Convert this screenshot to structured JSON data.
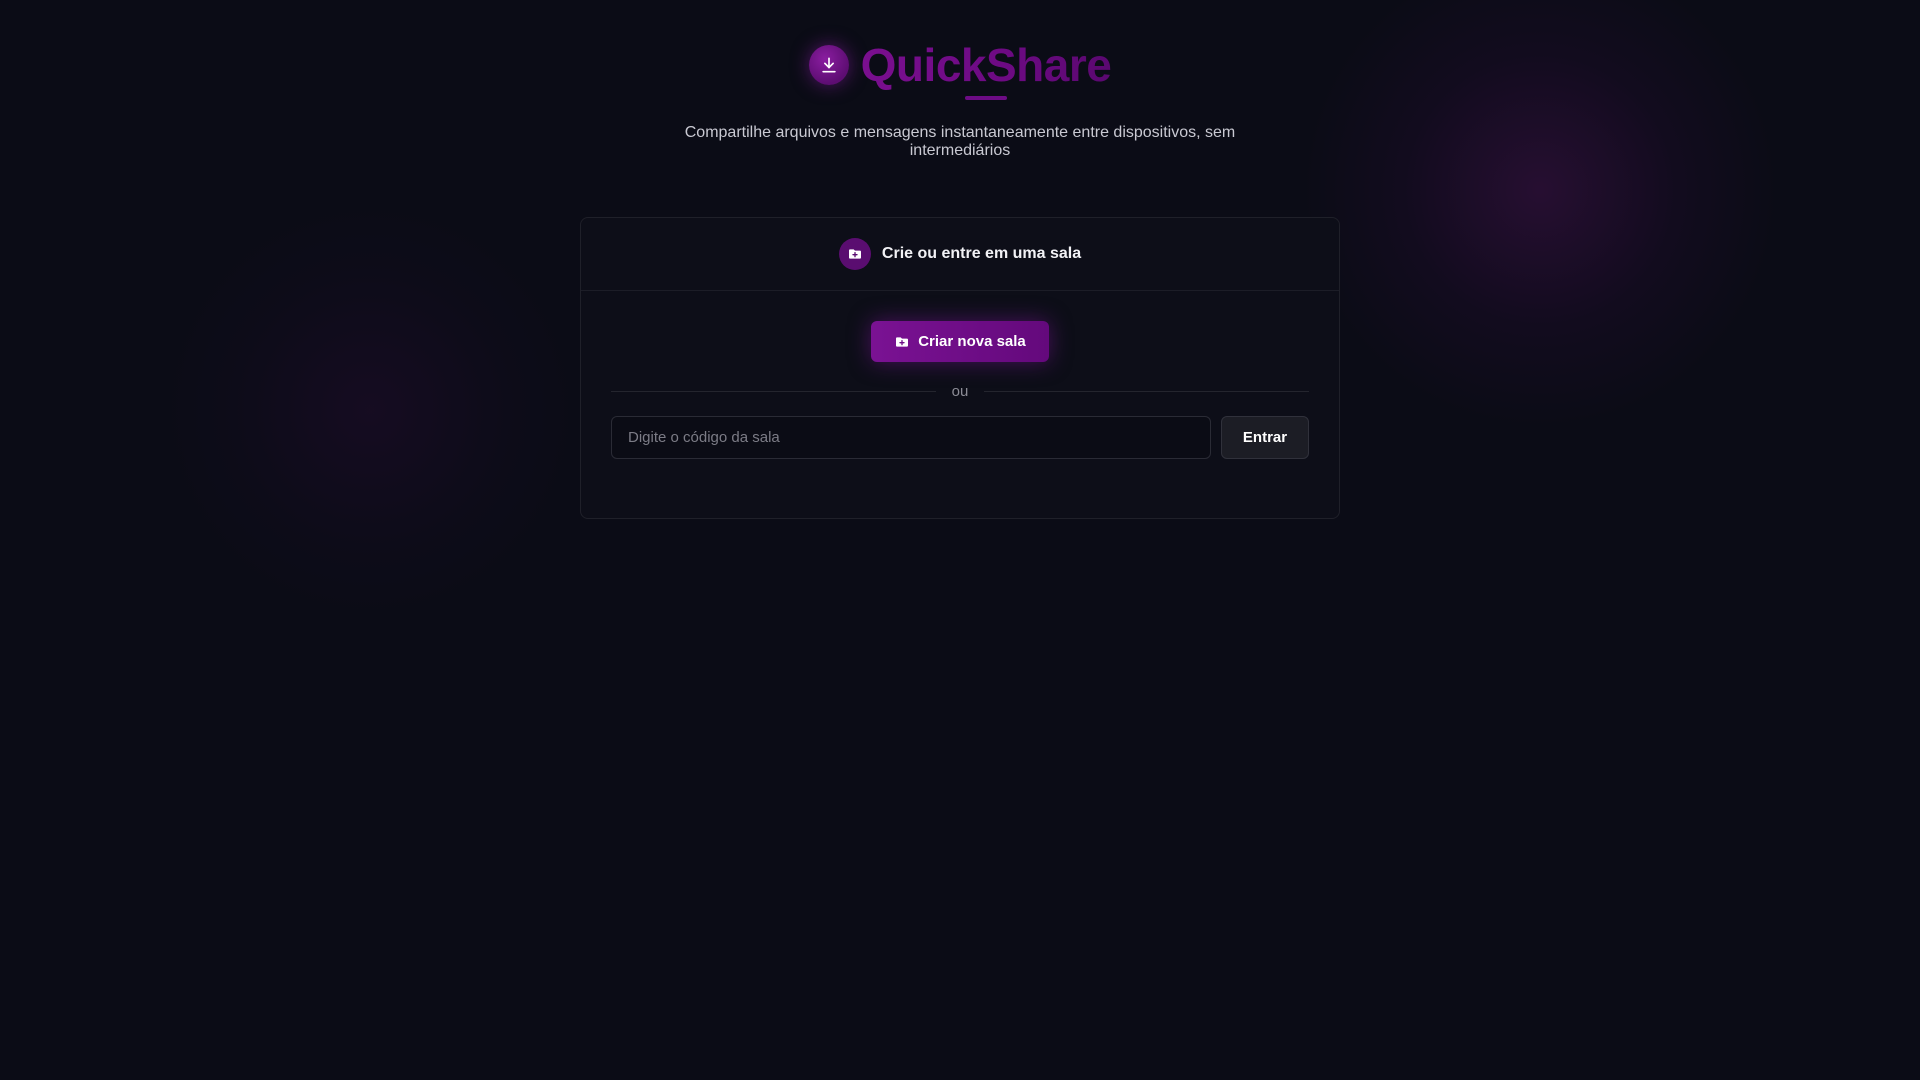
{
  "app": {
    "title": "QuickShare",
    "tagline": "Compartilhe arquivos e mensagens instantaneamente entre dispositivos, sem intermediários",
    "logo_icon": "download-icon"
  },
  "room_card": {
    "title": "Crie ou entre em uma sala",
    "header_icon": "folder-plus-icon",
    "create_button": {
      "label": "Criar nova sala",
      "icon": "folder-plus-icon"
    },
    "divider_text": "ou",
    "code_input": {
      "placeholder": "Digite o código da sala",
      "value": ""
    },
    "join_button": {
      "label": "Entrar"
    }
  },
  "colors": {
    "background": "#0b0c16",
    "accent": "#7a1293",
    "brand_text": "#6c0a82",
    "card_background": "#0d0e18",
    "card_border": "#1f2029"
  }
}
